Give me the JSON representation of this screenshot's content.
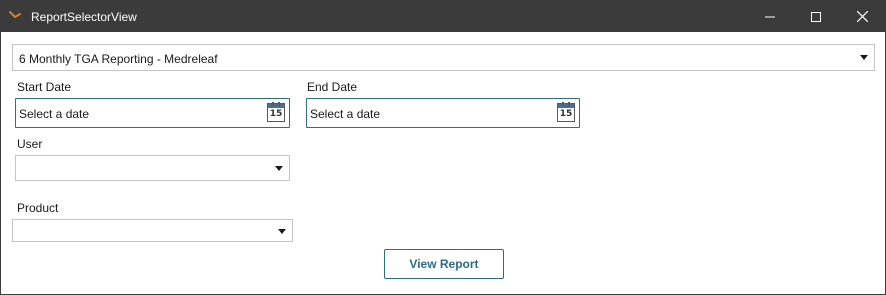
{
  "window": {
    "title": "ReportSelectorView",
    "icon": "app-logo-icon",
    "controls": [
      "minimize-icon",
      "maximize-icon",
      "close-icon"
    ]
  },
  "report_select": {
    "selected": "6 Monthly TGA Reporting - Medreleaf"
  },
  "start_date": {
    "label": "Start Date",
    "placeholder": "Select a date",
    "calendar_icon_text": "15"
  },
  "end_date": {
    "label": "End Date",
    "placeholder": "Select a date",
    "calendar_icon_text": "15"
  },
  "user": {
    "label": "User",
    "selected": ""
  },
  "product": {
    "label": "Product",
    "selected": ""
  },
  "actions": {
    "view_report_label": "View Report"
  },
  "colors": {
    "titlebar": "#3b3b3b",
    "accent": "#2b6d84",
    "app_icon": "#d9822b"
  }
}
